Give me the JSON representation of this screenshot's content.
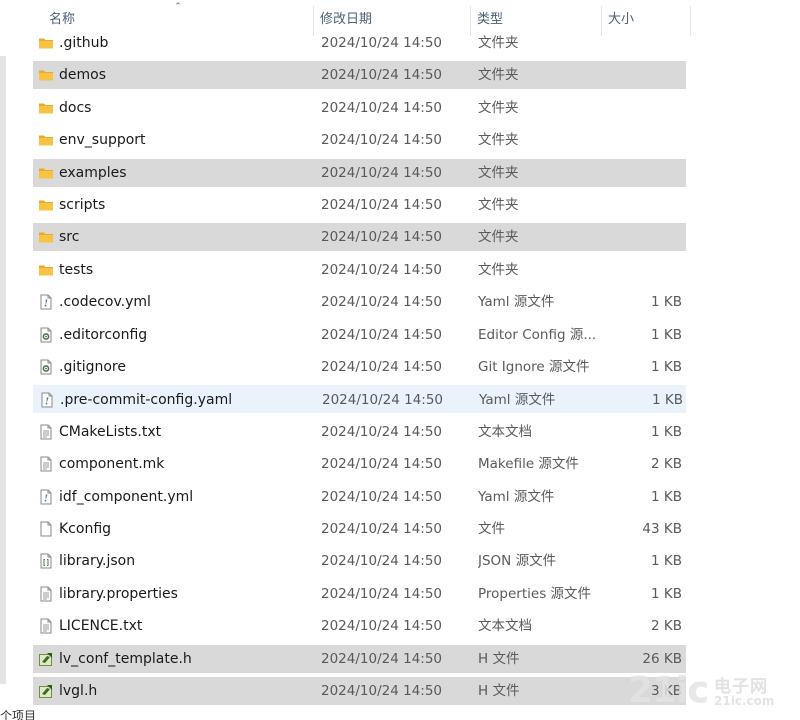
{
  "columns": {
    "name": "名称",
    "date": "修改日期",
    "type": "类型",
    "size": "大小"
  },
  "files": [
    {
      "name": ".github",
      "date": "2024/10/24 14:50",
      "type": "文件夹",
      "size": "",
      "icon": "folder-icon",
      "state": "normal"
    },
    {
      "name": "demos",
      "date": "2024/10/24 14:50",
      "type": "文件夹",
      "size": "",
      "icon": "folder-icon",
      "state": "selected"
    },
    {
      "name": "docs",
      "date": "2024/10/24 14:50",
      "type": "文件夹",
      "size": "",
      "icon": "folder-icon",
      "state": "normal"
    },
    {
      "name": "env_support",
      "date": "2024/10/24 14:50",
      "type": "文件夹",
      "size": "",
      "icon": "folder-icon",
      "state": "normal"
    },
    {
      "name": "examples",
      "date": "2024/10/24 14:50",
      "type": "文件夹",
      "size": "",
      "icon": "folder-icon",
      "state": "selected"
    },
    {
      "name": "scripts",
      "date": "2024/10/24 14:50",
      "type": "文件夹",
      "size": "",
      "icon": "folder-icon",
      "state": "normal"
    },
    {
      "name": "src",
      "date": "2024/10/24 14:50",
      "type": "文件夹",
      "size": "",
      "icon": "folder-icon",
      "state": "selected"
    },
    {
      "name": "tests",
      "date": "2024/10/24 14:50",
      "type": "文件夹",
      "size": "",
      "icon": "folder-icon",
      "state": "normal"
    },
    {
      "name": ".codecov.yml",
      "date": "2024/10/24 14:50",
      "type": "Yaml 源文件",
      "size": "1 KB",
      "icon": "yaml-file-icon",
      "state": "normal"
    },
    {
      "name": ".editorconfig",
      "date": "2024/10/24 14:50",
      "type": "Editor Config 源...",
      "size": "1 KB",
      "icon": "config-file-icon",
      "state": "normal"
    },
    {
      "name": ".gitignore",
      "date": "2024/10/24 14:50",
      "type": "Git Ignore 源文件",
      "size": "1 KB",
      "icon": "config-file-icon",
      "state": "normal"
    },
    {
      "name": ".pre-commit-config.yaml",
      "date": "2024/10/24 14:50",
      "type": "Yaml 源文件",
      "size": "1 KB",
      "icon": "yaml-file-icon",
      "state": "hover"
    },
    {
      "name": "CMakeLists.txt",
      "date": "2024/10/24 14:50",
      "type": "文本文档",
      "size": "1 KB",
      "icon": "text-file-icon",
      "state": "normal"
    },
    {
      "name": "component.mk",
      "date": "2024/10/24 14:50",
      "type": "Makefile 源文件",
      "size": "2 KB",
      "icon": "text-file-icon",
      "state": "normal"
    },
    {
      "name": "idf_component.yml",
      "date": "2024/10/24 14:50",
      "type": "Yaml 源文件",
      "size": "1 KB",
      "icon": "yaml-file-icon",
      "state": "normal"
    },
    {
      "name": "Kconfig",
      "date": "2024/10/24 14:50",
      "type": "文件",
      "size": "43 KB",
      "icon": "blank-file-icon",
      "state": "normal"
    },
    {
      "name": "library.json",
      "date": "2024/10/24 14:50",
      "type": "JSON 源文件",
      "size": "1 KB",
      "icon": "json-file-icon",
      "state": "normal"
    },
    {
      "name": "library.properties",
      "date": "2024/10/24 14:50",
      "type": "Properties 源文件",
      "size": "1 KB",
      "icon": "text-file-icon",
      "state": "normal"
    },
    {
      "name": "LICENCE.txt",
      "date": "2024/10/24 14:50",
      "type": "文本文档",
      "size": "2 KB",
      "icon": "text-file-icon",
      "state": "normal"
    },
    {
      "name": "lv_conf_template.h",
      "date": "2024/10/24 14:50",
      "type": "H 文件",
      "size": "26 KB",
      "icon": "header-file-icon",
      "state": "selected"
    },
    {
      "name": "lvgl.h",
      "date": "2024/10/24 14:50",
      "type": "H 文件",
      "size": "3 KB",
      "icon": "header-file-icon",
      "state": "selected"
    }
  ],
  "watermark": {
    "logo": "21ic",
    "cn": "电子网",
    "domain": "21ic.com"
  },
  "footer": {
    "status_text": "个项目"
  },
  "colors": {
    "selected_row": "#d9d9d9",
    "hover_row": "#eaf3fc",
    "folder": "#f6c344",
    "header_text": "#4c607a"
  }
}
